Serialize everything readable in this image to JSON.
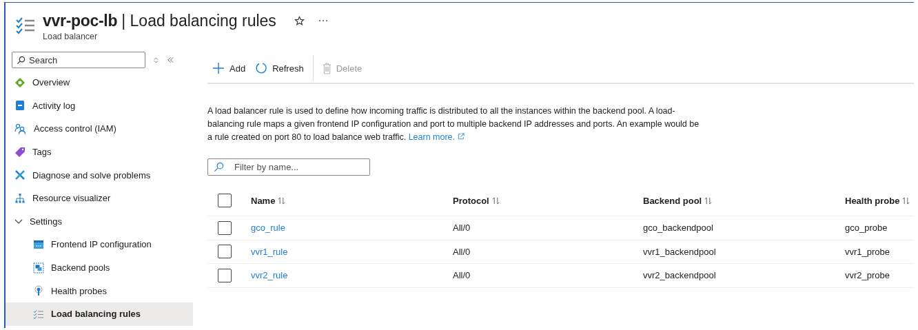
{
  "header": {
    "resource": "vvr-poc-lb",
    "separator": "|",
    "title": "Load balancing rules",
    "subtitle": "Load balancer"
  },
  "sidebar": {
    "search": {
      "placeholder": "Search"
    },
    "items": [
      {
        "label": "Overview",
        "selected": false
      },
      {
        "label": "Activity log",
        "selected": false
      },
      {
        "label": "Access control (IAM)",
        "selected": false
      },
      {
        "label": "Tags",
        "selected": false
      },
      {
        "label": "Diagnose and solve problems",
        "selected": false
      },
      {
        "label": "Resource visualizer",
        "selected": false
      },
      {
        "label": "Settings",
        "selected": false,
        "expanded": true,
        "children": [
          {
            "label": "Frontend IP configuration",
            "selected": false
          },
          {
            "label": "Backend pools",
            "selected": false
          },
          {
            "label": "Health probes",
            "selected": false
          },
          {
            "label": "Load balancing rules",
            "selected": true
          }
        ]
      }
    ]
  },
  "toolbar": [
    {
      "label": "Add",
      "disabled": false
    },
    {
      "label": "Refresh",
      "disabled": false
    },
    {
      "label": "Delete",
      "disabled": true
    }
  ],
  "description": {
    "text": "A load balancer rule is used to define how incoming traffic is distributed to all the instances within the backend pool. A load-balancing rule maps a given frontend IP configuration and port to multiple backend IP addresses and ports. An example would be a rule created on port 80 to load balance web traffic.",
    "link": "Learn more."
  },
  "filter": {
    "placeholder": "Filter by name..."
  },
  "table": {
    "all_checked": false,
    "columns": [
      "Name",
      "Protocol",
      "Backend pool",
      "Health probe"
    ],
    "rows": [
      {
        "checked": false,
        "cells": [
          "gco_rule",
          "All/0",
          "gco_backendpool",
          "gco_probe"
        ]
      },
      {
        "checked": false,
        "cells": [
          "vvr1_rule",
          "All/0",
          "vvr1_backendpool",
          "vvr1_probe"
        ]
      },
      {
        "checked": false,
        "cells": [
          "vvr2_rule",
          "All/0",
          "vvr2_backendpool",
          "vvr2_probe"
        ]
      }
    ]
  }
}
